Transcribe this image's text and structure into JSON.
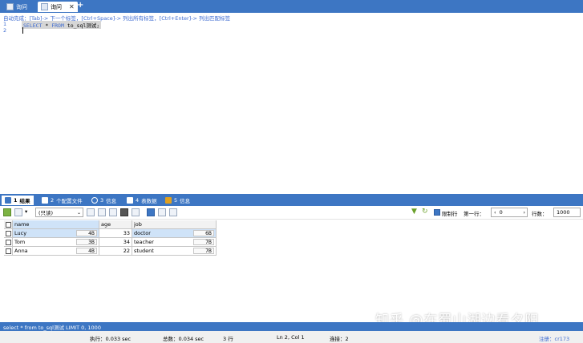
{
  "tabs": [
    {
      "label": "询问",
      "active": false
    },
    {
      "label": "询问",
      "active": true
    }
  ],
  "editor": {
    "hint": "自动完成：[Tab]-> 下一个标签，[Ctrl+Space]-> 列出所有标签，[Ctrl+Enter]-> 列出匹配标签",
    "line_numbers": [
      "1",
      "2"
    ],
    "code": {
      "kw1": "SELECT",
      "star": " * ",
      "kw2": "FROM",
      "rest": " to_sql测试;"
    }
  },
  "result_tabs": [
    {
      "num": "1",
      "label": "结果",
      "active": true,
      "color": "#3d76c3"
    },
    {
      "num": "2",
      "label": "个配置文件",
      "active": false,
      "color": "#3d76c3"
    },
    {
      "num": "3",
      "label": "信息",
      "active": false,
      "color": "#3d76c3"
    },
    {
      "num": "4",
      "label": "表数据",
      "active": false,
      "color": "#3d76c3"
    },
    {
      "num": "5",
      "label": "信息",
      "active": false,
      "color": "#e0a020"
    }
  ],
  "toolbar": {
    "mode": "(只读)",
    "limit_label": "限制行",
    "first_row_label": "第一行：",
    "first_row_value": "0",
    "rows_label": "行数：",
    "rows_value": "1000"
  },
  "grid": {
    "columns": [
      "name",
      "age",
      "job"
    ],
    "rows": [
      {
        "name": "Lucy",
        "name_size": "4B",
        "age": "33",
        "job": "doctor",
        "job_size": "6B"
      },
      {
        "name": "Tom",
        "name_size": "3B",
        "age": "34",
        "job": "teacher",
        "job_size": "7B"
      },
      {
        "name": "Anna",
        "name_size": "4B",
        "age": "22",
        "job": "student",
        "job_size": "7B"
      }
    ]
  },
  "watermark": "知乎 @在蜀山湖边看夕阳",
  "sql_status": "select * from to_sql测试 LIMIT 0, 1000",
  "status": {
    "exec": "执行：0.033 sec",
    "total": "总数：0.034 sec",
    "rows": "3 行",
    "position": "Ln 2, Col 1",
    "connection": "连接：2",
    "user": "注册：cr173"
  },
  "colors": {
    "accent": "#3d76c3",
    "selection": "#cfe3f8",
    "keyword": "#3d6bd1"
  }
}
